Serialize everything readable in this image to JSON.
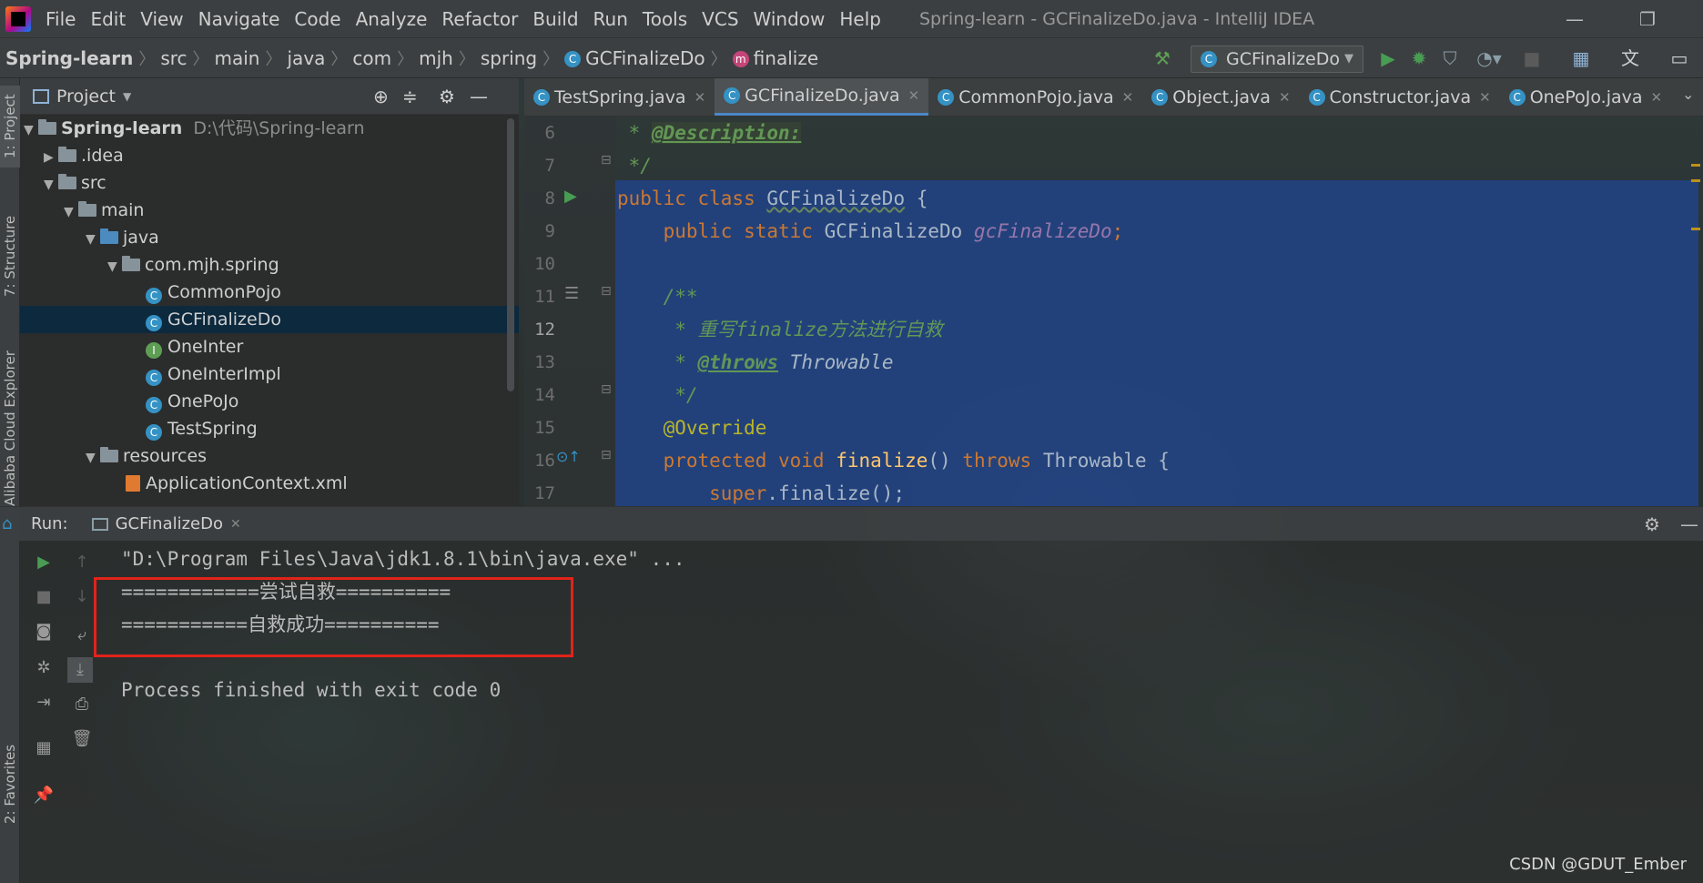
{
  "menubar": {
    "items": [
      "File",
      "Edit",
      "View",
      "Navigate",
      "Code",
      "Analyze",
      "Refactor",
      "Build",
      "Run",
      "Tools",
      "VCS",
      "Window",
      "Help"
    ],
    "title": "Spring-learn - GCFinalizeDo.java - IntelliJ IDEA"
  },
  "breadcrumb": [
    "Spring-learn",
    "src",
    "main",
    "java",
    "com",
    "mjh",
    "spring",
    "GCFinalizeDo",
    "finalize"
  ],
  "run_config": "GCFinalizeDo",
  "left_stripe": {
    "project": "1: Project",
    "structure": "7: Structure",
    "cloud": "Alibaba Cloud Explorer",
    "favorites": "2: Favorites"
  },
  "project_panel": {
    "title": "Project",
    "tree": [
      {
        "label": "Spring-learn",
        "path": "D:\\代码\\Spring-learn"
      },
      {
        "label": ".idea"
      },
      {
        "label": "src"
      },
      {
        "label": "main"
      },
      {
        "label": "java"
      },
      {
        "label": "com.mjh.spring"
      },
      {
        "label": "CommonPojo"
      },
      {
        "label": "GCFinalizeDo"
      },
      {
        "label": "OneInter"
      },
      {
        "label": "OneInterImpl"
      },
      {
        "label": "OnePoJo"
      },
      {
        "label": "TestSpring"
      },
      {
        "label": "resources"
      },
      {
        "label": "ApplicationContext.xml"
      }
    ]
  },
  "editor": {
    "tabs": [
      "TestSpring.java",
      "GCFinalizeDo.java",
      "CommonPojo.java",
      "Object.java",
      "Constructor.java",
      "OnePoJo.java"
    ],
    "active_tab": "GCFinalizeDo.java",
    "line_numbers": [
      "6",
      "7",
      "8",
      "9",
      "10",
      "11",
      "12",
      "13",
      "14",
      "15",
      "16",
      "17"
    ],
    "current_line": "12",
    "lines": {
      "l6_star": " * ",
      "l6_tag": "@Description:",
      "l7": " */",
      "l8_kw": "public class ",
      "l8_name": "GCFinalizeDo",
      "l8_brace": " {",
      "l9_kw": "    public static ",
      "l9_type": "GCFinalizeDo ",
      "l9_field": "gcFinalizeDo",
      "l9_semi": ";",
      "l11": "    /**",
      "l12": "     * 重写finalize方法进行自救",
      "l13_star": "     * ",
      "l13_tag": "@throws",
      "l13_text": " Throwable",
      "l14": "     */",
      "l15": "    @Override",
      "l16_kw": "    protected void ",
      "l16_fn": "finalize",
      "l16_paren": "() ",
      "l16_throws": "throws ",
      "l16_rest": "Throwable {",
      "l17_kw": "        super",
      "l17_rest": ".finalize();"
    }
  },
  "run_panel": {
    "label": "Run:",
    "tab": "GCFinalizeDo",
    "output": [
      "\"D:\\Program Files\\Java\\jdk1.8.1\\bin\\java.exe\" ...",
      "============尝试自救==========",
      "===========自救成功==========",
      "",
      "Process finished with exit code 0"
    ]
  },
  "watermark": "CSDN @GDUT_Ember",
  "colors": {
    "selection": "#214283",
    "accent": "#4a88c7",
    "highlight_box": "#e2231a",
    "run_green": "#499c54"
  }
}
